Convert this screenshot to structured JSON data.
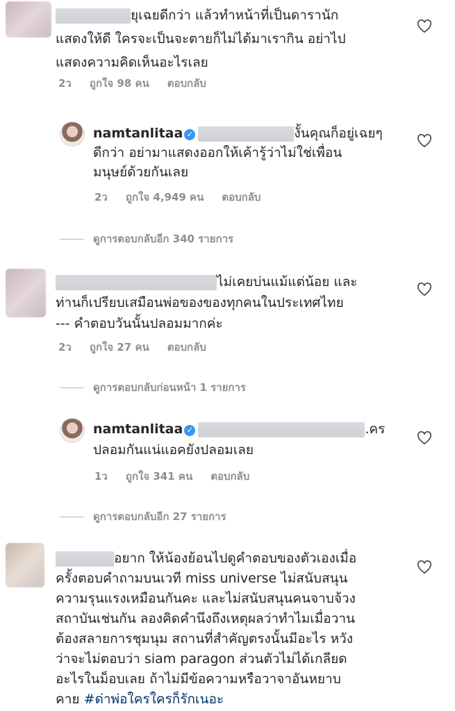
{
  "comments": [
    {
      "lines": [
        "ยุเฉยดีกว่า แล้วทำหน้าที่เป็นดารานัก",
        "แสดงให้ดี ใครจะเป็นจะตายก็ไม่ได้มาเรากิน อย่าไป",
        "แสดงความคิดเห็นอะไรเลย"
      ],
      "time": "2ว",
      "likes": "ถูกใจ 98 คน",
      "reply": "ตอบกลับ"
    },
    {
      "username": "namtanlitaa",
      "lines": [
        "งั้นคุณก็อยู่เฉยๆ",
        "ดีกว่า อย่ามาแสดงออกให้เค้ารู้ว่าไม่ใช่เพื่อน",
        "มนุษย์ด้วยกันเลย"
      ],
      "time": "2ว",
      "likes": "ถูกใจ 4,949 คน",
      "reply": "ตอบกลับ",
      "view_more": "ดูการตอบกลับอีก 340 รายการ"
    },
    {
      "lines": [
        "ไม่เคยบ่นแม้แต่น้อย และ",
        "ท่านก็เปรียบเสมือนพ่อของของทุกคนในประเทศไทย",
        "--- คำตอบวันนั้นปลอมมากค่ะ"
      ],
      "time": "2ว",
      "likes": "ถูกใจ 27 คน",
      "reply": "ตอบกลับ",
      "view_prev": "ดูการตอบกลับก่อนหน้า 1 รายการ"
    },
    {
      "username": "namtanlitaa",
      "lines": [
        ".คร",
        "ปลอมกันแน่แอคยังปลอมเลย"
      ],
      "time": "1ว",
      "likes": "ถูกใจ 341 คน",
      "reply": "ตอบกลับ",
      "view_more": "ดูการตอบกลับอีก 27 รายการ"
    },
    {
      "lines": [
        "อยาก ให้น้องย้อนไปดูคำตอบของตัวเองเมื่อ",
        "ครั้งตอบคำถามบนเวที miss universe ไม่สนับสนุน",
        "ความรุนแรงเหมือนกันคะ และไม่สนับสนุนคนจาบจ้วง",
        "สถาบันเช่นกัน ลองคิดคำนึงถึงเหตุผลว่าทำไมเมื่อวาน",
        "ต้องสลายการชุมนุม สถานที่สำคัญตรงนั้นมีอะไร หวัง",
        "ว่าจะไม่ตอบว่า siam paragon ส่วนตัวไม่ได้เกลียด",
        "อะไรในม็อบเลย ถ้าไม่มีข้อความหรือวาจาอันหยาบ"
      ],
      "last_prefix": "คาย ",
      "hashtag": "#ด่าพ่อใครใครก็รักเนอะ"
    }
  ],
  "icons": {
    "like": "heart-icon",
    "verified": "verified-badge-icon"
  },
  "colors": {
    "verified": "#3897f0",
    "meta": "#8e8e8e",
    "hashtag": "#003569"
  }
}
